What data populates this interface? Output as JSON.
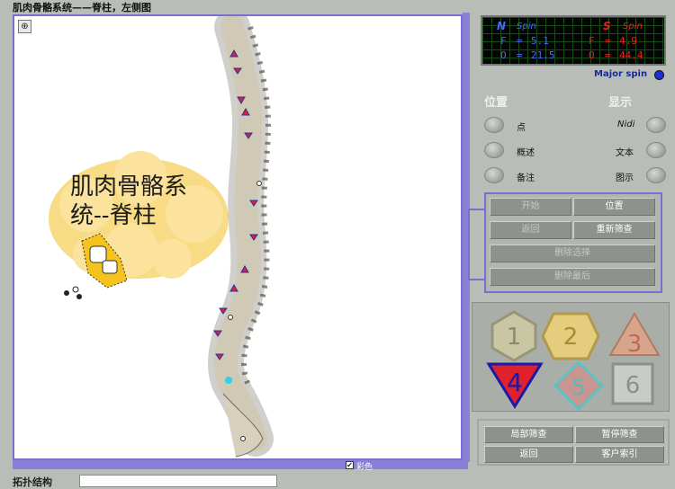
{
  "window": {
    "title": "肌肉骨骼系统——脊柱，左侧图"
  },
  "viewer": {
    "zoom_icon": "magnifier-icon",
    "caption_line1": "肌肉骨骼系",
    "caption_line2": "统--脊柱",
    "color_checked": true,
    "color_check_glyph": "✔",
    "color_label": "彩色",
    "topology_label": "拓扑结构",
    "topology_value": ""
  },
  "spin": {
    "n_label": "N",
    "n_spin": "Spin",
    "n_f_label": "F",
    "n_f_value": "5.1",
    "n_o_label": "O",
    "n_o_value": "21.5",
    "s_label": "S",
    "s_spin": "Spin",
    "s_f_label": "F",
    "s_f_value": "4.9",
    "s_o_label": "O",
    "s_o_value": "44.4",
    "eq": "=",
    "major_label": "Major spin",
    "major_color": "#1b2fd8"
  },
  "position": {
    "heading": "位置",
    "items": [
      "点",
      "概述",
      "备注"
    ]
  },
  "display": {
    "heading": "显示",
    "items": [
      "Nidi",
      "文本",
      "图示"
    ]
  },
  "commands": {
    "start": "开始",
    "position": "位置",
    "back": "返回",
    "refilter": "重新筛查",
    "delete_selection": "删除选择",
    "delete_last": "删除最后"
  },
  "shapes": [
    "1",
    "2",
    "3",
    "4",
    "5",
    "6"
  ],
  "shape_colors": {
    "active": "#e0202a",
    "active_border": "#1a1aa8"
  },
  "bottom": {
    "local_filter": "局部筛查",
    "pause_filter": "暂停筛查",
    "back": "返回",
    "client_index": "客户索引"
  }
}
